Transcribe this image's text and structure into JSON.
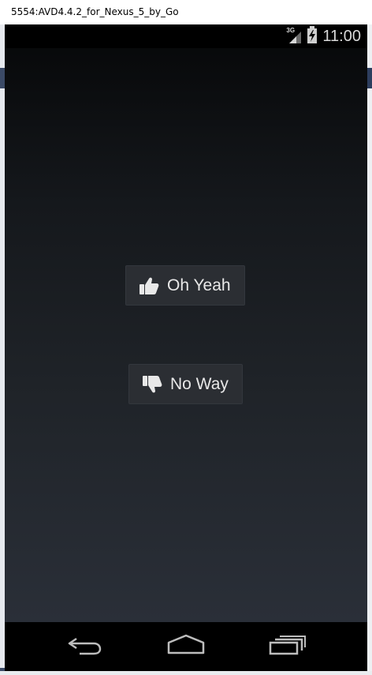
{
  "window": {
    "title": "5554:AVD4.4.2_for_Nexus_5_by_Go"
  },
  "status_bar": {
    "network": "3G",
    "time": "11:00"
  },
  "buttons": {
    "yeah_label": "Oh Yeah",
    "noway_label": "No Way"
  },
  "icons": {
    "yeah": "thumbs-up-icon",
    "noway": "thumbs-down-icon",
    "back": "back-icon",
    "home": "home-icon",
    "recents": "recent-apps-icon",
    "signal": "signal-icon",
    "battery": "battery-icon"
  },
  "colors": {
    "screen_top": "#060708",
    "screen_bottom": "#2a2f38",
    "button_bg": "#2b2e33",
    "text": "#e8e8e8"
  }
}
